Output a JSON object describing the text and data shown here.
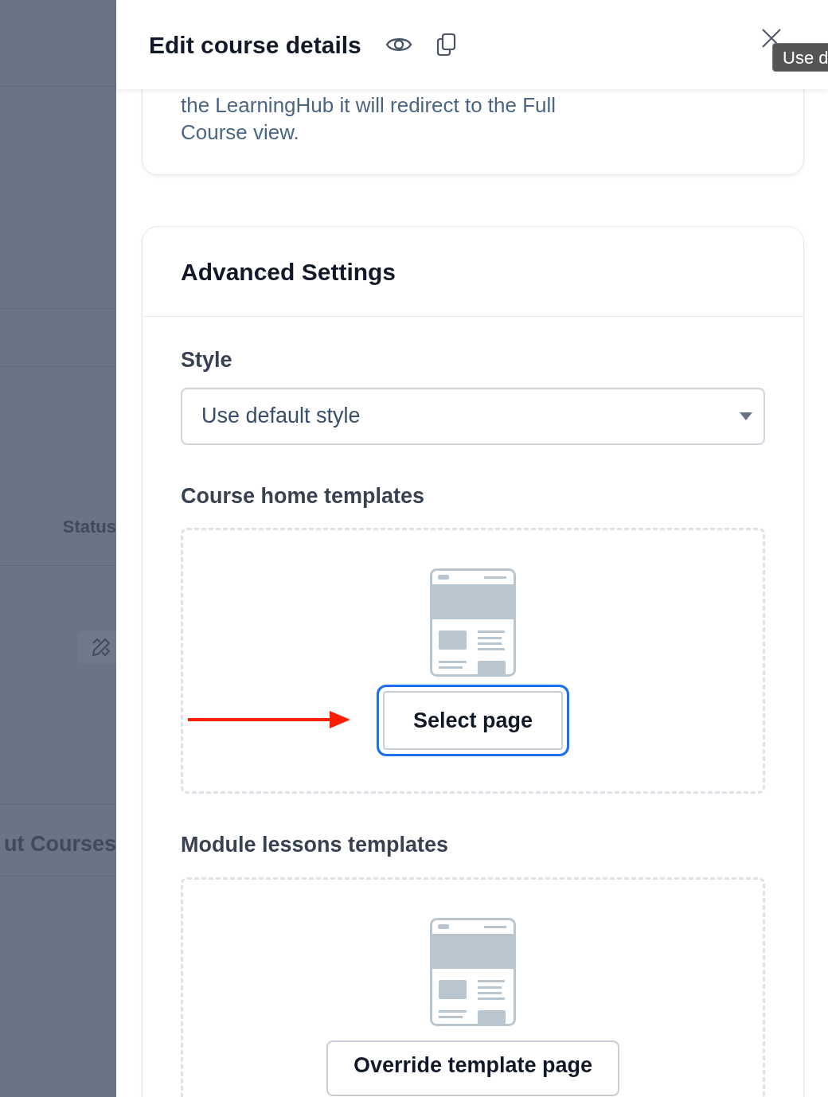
{
  "backdrop": {
    "column_label": "Status",
    "row_text": "ut Courses"
  },
  "drawer": {
    "title": "Edit course details",
    "tooltip": "Use d",
    "intro_card": {
      "lines": [
        "the LearningHub it will redirect to the Full",
        "Course view."
      ]
    },
    "advanced_settings": {
      "title": "Advanced Settings",
      "style": {
        "label": "Style",
        "value": "Use default style"
      },
      "templates": [
        {
          "label": "Course home templates",
          "button": "Select page",
          "focused": true
        },
        {
          "label": "Module lessons templates",
          "button": "Override template page",
          "focused": false
        }
      ]
    }
  }
}
